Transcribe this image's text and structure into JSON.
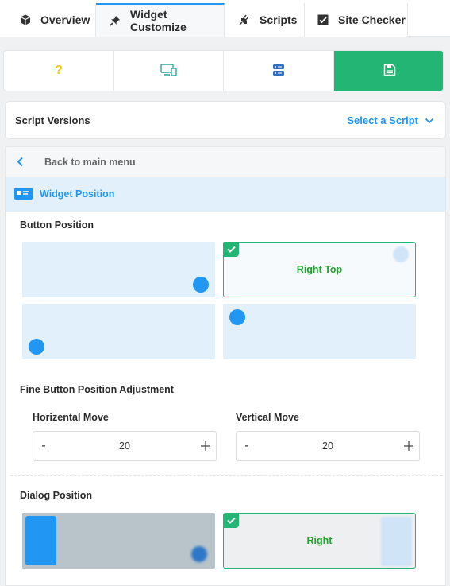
{
  "tabs": [
    {
      "label": "Overview",
      "icon": "cube-icon"
    },
    {
      "label": "Widget Customize",
      "icon": "pin-icon"
    },
    {
      "label": "Scripts",
      "icon": "plug-icon"
    },
    {
      "label": "Site Checker",
      "icon": "checker-icon"
    }
  ],
  "toolbar": {
    "buttons": [
      {
        "icon": "question-icon",
        "color": "#f5c518"
      },
      {
        "icon": "devices-icon",
        "color": "#2aa7a0"
      },
      {
        "icon": "server-icon",
        "color": "#2b6fc9"
      },
      {
        "icon": "save-icon",
        "color": "#ffffff",
        "active_bg": "#22b573"
      }
    ]
  },
  "script_versions": {
    "label": "Script Versions",
    "select_label": "Select a Script"
  },
  "panel": {
    "back_label": "Back to main menu",
    "section_title": "Widget Position",
    "button_position": {
      "heading": "Button Position",
      "options": [
        {
          "name": "right-bottom",
          "label": ""
        },
        {
          "name": "right-top",
          "label": "Right Top",
          "selected": true
        },
        {
          "name": "left-bottom",
          "label": ""
        },
        {
          "name": "left-top",
          "label": ""
        }
      ]
    },
    "fine_adjust": {
      "heading": "Fine Button Position Adjustment",
      "horizontal": {
        "label": "Horizental Move",
        "value": "20",
        "minus": "-"
      },
      "vertical": {
        "label": "Vertical Move",
        "value": "20",
        "minus": "-"
      }
    },
    "dialog_position": {
      "heading": "Dialog Position",
      "options": [
        {
          "name": "left",
          "label": ""
        },
        {
          "name": "right",
          "label": "Right",
          "selected": true
        }
      ]
    }
  },
  "colors": {
    "accent": "#2196f3",
    "green": "#22b573",
    "selected_text": "#22a22f",
    "highlight_bg": "#e1f0fb"
  }
}
